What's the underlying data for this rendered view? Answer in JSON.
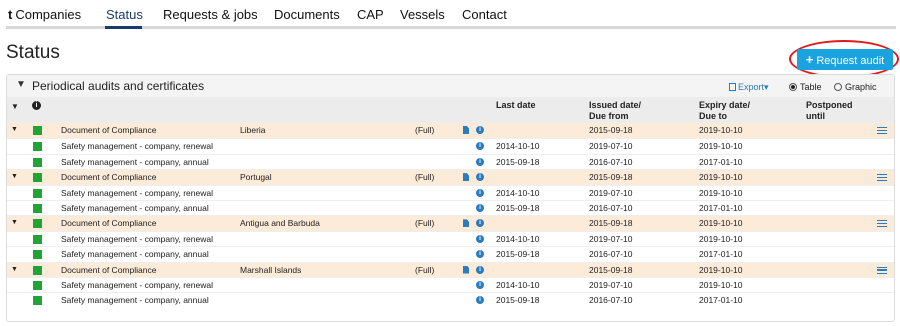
{
  "nav": {
    "brand_t": "t",
    "brand_label": "Companies",
    "items": [
      "Status",
      "Requests & jobs",
      "Documents",
      "CAP",
      "Vessels",
      "Contact"
    ],
    "active": "Status"
  },
  "page_title": "Status",
  "request_button": {
    "icon": "plus-icon",
    "label": "Request audit"
  },
  "panel": {
    "title": "Periodical audits and certificates",
    "export_label": "Export▾",
    "view_options": [
      "Table",
      "Graphic"
    ],
    "selected_view": "Table"
  },
  "columns": {
    "last_date": "Last date",
    "issued_1": "Issued date/",
    "issued_2": "Due from",
    "expiry_1": "Expiry date/",
    "expiry_2": "Due to",
    "postponed_1": "Postponed",
    "postponed_2": "until"
  },
  "colors": {
    "accent": "#1aa3df",
    "status_green": "#21a336",
    "main_row_bg": "#fcebd8",
    "highlight_ring": "#e01a1a"
  },
  "groups": [
    {
      "main": {
        "name": "Document of Compliance",
        "flag": "Liberia",
        "scope": "(Full)",
        "issued": "2015-09-18",
        "expiry": "2019-10-10"
      },
      "subs": [
        {
          "name": "Safety management - company, renewal",
          "last": "2014-10-10",
          "issued": "2019-07-10",
          "expiry": "2019-10-10"
        },
        {
          "name": "Safety management - company, annual",
          "last": "2015-09-18",
          "issued": "2016-07-10",
          "expiry": "2017-01-10"
        }
      ]
    },
    {
      "main": {
        "name": "Document of Compliance",
        "flag": "Portugal",
        "scope": "(Full)",
        "issued": "2015-09-18",
        "expiry": "2019-10-10"
      },
      "subs": [
        {
          "name": "Safety management - company, renewal",
          "last": "2014-10-10",
          "issued": "2019-07-10",
          "expiry": "2019-10-10"
        },
        {
          "name": "Safety management - company, annual",
          "last": "2015-09-18",
          "issued": "2016-07-10",
          "expiry": "2017-01-10"
        }
      ]
    },
    {
      "main": {
        "name": "Document of Compliance",
        "flag": "Antigua and Barbuda",
        "scope": "(Full)",
        "issued": "2015-09-18",
        "expiry": "2019-10-10"
      },
      "subs": [
        {
          "name": "Safety management - company, renewal",
          "last": "2014-10-10",
          "issued": "2019-07-10",
          "expiry": "2019-10-10"
        },
        {
          "name": "Safety management - company, annual",
          "last": "2015-09-18",
          "issued": "2016-07-10",
          "expiry": "2017-01-10"
        }
      ]
    },
    {
      "main": {
        "name": "Document of Compliance",
        "flag": "Marshall Islands",
        "scope": "(Full)",
        "issued": "2015-09-18",
        "expiry": "2019-10-10"
      },
      "subs": [
        {
          "name": "Safety management - company, renewal",
          "last": "2014-10-10",
          "issued": "2019-07-10",
          "expiry": "2019-10-10"
        },
        {
          "name": "Safety management - company, annual",
          "last": "2015-09-18",
          "issued": "2016-07-10",
          "expiry": "2017-01-10"
        }
      ]
    }
  ]
}
